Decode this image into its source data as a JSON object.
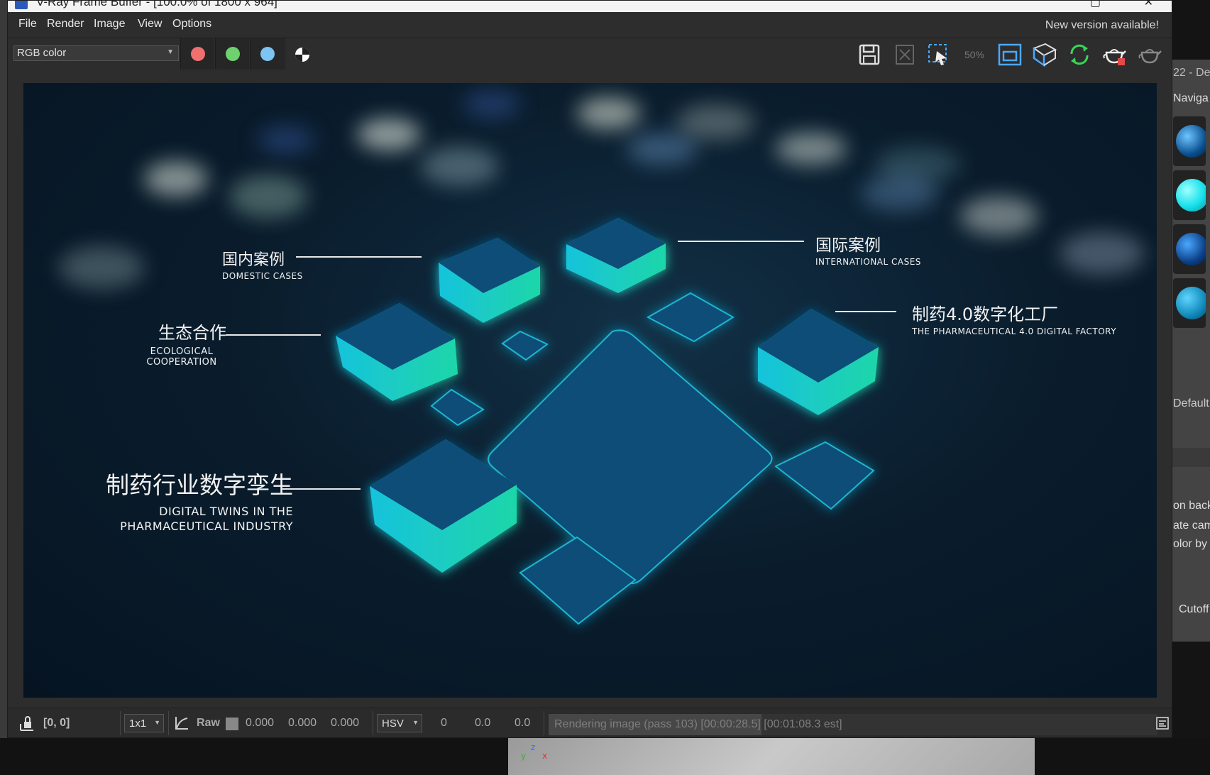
{
  "window": {
    "title": "V-Ray Frame Buffer - [100.0% of 1800 x 964]",
    "controls": [
      "▢",
      "✕"
    ]
  },
  "menu": [
    "File",
    "Render",
    "Image",
    "View",
    "Options"
  ],
  "new_version": "New version available!",
  "toolbar": {
    "channel_select": "RGB color",
    "channels": [
      {
        "name": "red-channel",
        "color": "#f07070"
      },
      {
        "name": "green-channel",
        "color": "#6fd06f"
      },
      {
        "name": "blue-channel",
        "color": "#7cc4f2"
      }
    ],
    "zoom_label": "50%",
    "icons": [
      "save-icon",
      "clear-icon",
      "region-render-icon",
      "zoom-icon",
      "region-icon",
      "camera-track-icon",
      "refresh-icon",
      "render-teapot-icon",
      "render-last-icon"
    ]
  },
  "scene": {
    "labels": [
      {
        "id": "domestic",
        "zh": "国内案例",
        "en": [
          "DOMESTIC CASES"
        ]
      },
      {
        "id": "international",
        "zh": "国际案例",
        "en": [
          "INTERNATIONAL CASES"
        ]
      },
      {
        "id": "ecological",
        "zh": "生态合作",
        "en": [
          "ECOLOGICAL",
          "COOPERATION"
        ]
      },
      {
        "id": "pharma_factory",
        "zh": "制药4.0数字化工厂",
        "en": [
          "THE PHARMACEUTICAL 4.0 DIGITAL FACTORY"
        ]
      },
      {
        "id": "digital_twins",
        "zh": "制药行业数字孪生",
        "en": [
          "DIGITAL TWINS IN THE",
          "PHARMACEUTICAL INDUSTRY"
        ]
      }
    ]
  },
  "status": {
    "coords": "[0, 0]",
    "ratio": "1x1",
    "raw_label": "Raw",
    "rgb": [
      "0.000",
      "0.000",
      "0.000"
    ],
    "mode": "HSV",
    "hsv": [
      "0",
      "0.0",
      "0.0"
    ],
    "progress_text": "Rendering image (pass 103) [00:00:28.5] [00:01:08.3 est]",
    "progress_fraction": 0.35
  },
  "side_panel": {
    "texts": [
      "22 - De",
      "Naviga",
      "Default",
      "on back",
      "ate came",
      "olor by c",
      "Cutoff"
    ]
  },
  "viewport_axis": {
    "x": "x",
    "y": "y",
    "z": "z"
  }
}
